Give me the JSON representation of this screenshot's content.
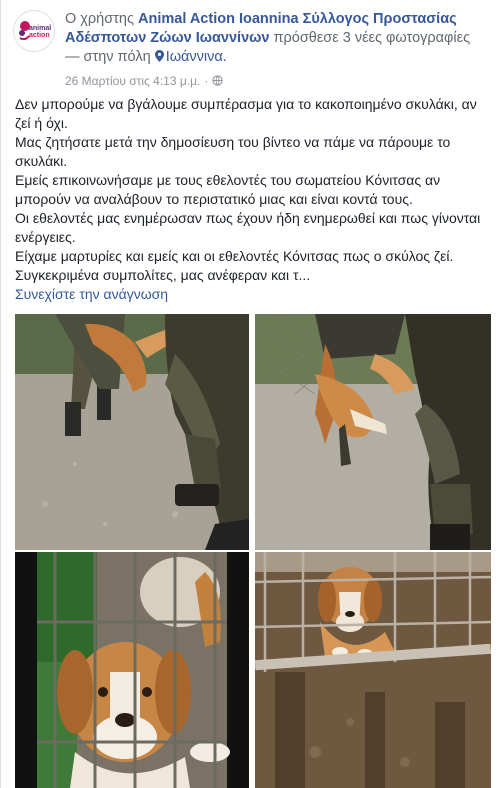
{
  "header": {
    "prefix": "Ο χρήστης",
    "page_name": "Animal Action Ioannina Σύλλογος Προστασίας Αδέσποτων Ζώων Ιωαννίνων",
    "action": "πρόσθεσε 3 νέες φωτογραφίες",
    "location_prefix": "— στην πόλη",
    "location": "Ιωάννινα.",
    "timestamp": "26 Μαρτίου στις 4:13 μ.μ.",
    "separator": "·",
    "avatar_logo_line1": "animal",
    "avatar_logo_line2": "action"
  },
  "post": {
    "paragraphs": [
      "Δεν μπορούμε να βγάλουμε συμπέρασμα για το κακοποιημένο σκυλάκι, αν ζεί ή όχι.",
      "Μας ζητήσατε μετά την δημοσίευση του βίντεο να πάμε να πάρουμε το σκυλάκι.",
      "Εμείς επικοινωνήσαμε με τους εθελοντές του σωματείου Κόνιτσας αν μπορούν να αναλάβουν το περιστατικό μιας και είναι κοντά τους.",
      "Οι εθελοντές μας ενημέρωσαν πως έχουν ήδη ενημερωθεί και πως γίνονται ενέργειες.",
      "Είχαμε μαρτυρίες και εμείς και οι εθελοντές Κόνιτσας πως ο σκύλος ζεί.",
      "Συγκεκριμένα συμπολίτες, μας ανέφεραν και τ..."
    ],
    "see_more": "Συνεχίστε την ανάγνωση"
  },
  "colors": {
    "link": "#365899",
    "meta": "#90949c",
    "text": "#1d2129",
    "brand_pink": "#c2185b",
    "brand_purple": "#5e2b7e"
  },
  "icons": [
    "location-pin-icon",
    "globe-icon"
  ]
}
